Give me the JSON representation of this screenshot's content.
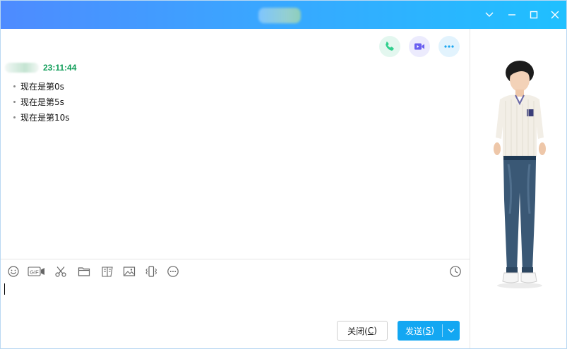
{
  "titlebar": {
    "controls": [
      {
        "name": "collapse-icon"
      },
      {
        "name": "minimize-icon"
      },
      {
        "name": "maximize-icon"
      },
      {
        "name": "close-icon"
      }
    ]
  },
  "header_actions": [
    {
      "name": "voice-call-icon",
      "color": "#2fcf8d",
      "bg": "#e3f7ef"
    },
    {
      "name": "video-call-icon",
      "color": "#6a5ff0",
      "bg": "#ecebfd"
    },
    {
      "name": "more-icon",
      "color": "#1ba6f0",
      "bg": "#e2f3fd"
    }
  ],
  "chat": {
    "time": "23:11:44",
    "messages": [
      "现在是第0s",
      "现在是第5s",
      "现在是第10s"
    ]
  },
  "toolbar": {
    "icons": [
      "emoji-icon",
      "gif-icon",
      "screenshot-scissors-icon",
      "folder-icon",
      "favorites-icon",
      "image-icon",
      "shake-window-icon",
      "more-options-icon"
    ],
    "gif_label": "GIF",
    "history_icon": "clock-icon"
  },
  "buttons": {
    "close_text": "关闭(",
    "close_key": "C",
    "close_end": ")",
    "send_text": "发送(",
    "send_key": "S",
    "send_end": ")"
  },
  "colors": {
    "accent": "#13a7f2",
    "time_green": "#0f9d58",
    "title_gradient_start": "#4e8bff",
    "title_gradient_end": "#1fc0ff"
  }
}
